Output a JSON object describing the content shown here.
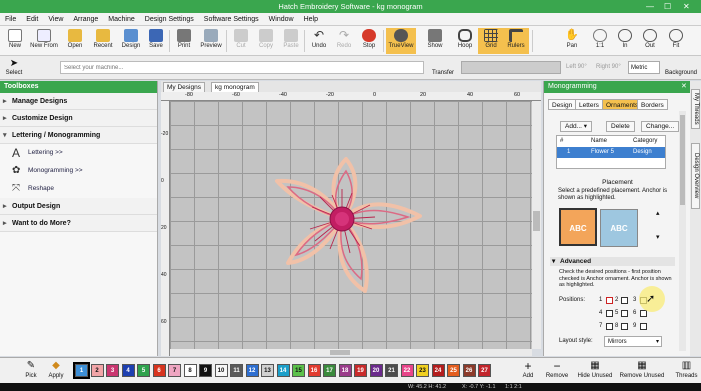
{
  "window": {
    "title": "Hatch Embroidery Software - kg monogram",
    "minimize": "—",
    "maximize": "☐",
    "close": "✕"
  },
  "menu": [
    "File",
    "Edit",
    "View",
    "Arrange",
    "Machine",
    "Design Settings",
    "Software Settings",
    "Window",
    "Help"
  ],
  "toolbar": [
    {
      "label": "New",
      "icon": "new-file-icon"
    },
    {
      "label": "New From",
      "icon": "new-from-icon"
    },
    {
      "label": "Open",
      "icon": "open-folder-icon"
    },
    {
      "label": "Recent",
      "icon": "recent-icon"
    },
    {
      "label": "Design",
      "icon": "design-icon"
    },
    {
      "label": "Save",
      "icon": "save-icon"
    },
    {
      "label": "Print",
      "icon": "print-icon"
    },
    {
      "label": "Preview",
      "icon": "preview-icon"
    },
    {
      "label": "Cut",
      "icon": "cut-icon"
    },
    {
      "label": "Copy",
      "icon": "copy-icon"
    },
    {
      "label": "Paste",
      "icon": "paste-icon"
    },
    {
      "label": "Undo",
      "icon": "undo-icon"
    },
    {
      "label": "Redo",
      "icon": "redo-icon"
    },
    {
      "label": "Stop",
      "icon": "stop-icon"
    },
    {
      "label": "TrueView",
      "icon": "trueview-icon"
    },
    {
      "label": "Show",
      "icon": "show-icon"
    },
    {
      "label": "Hoop",
      "icon": "hoop-icon"
    },
    {
      "label": "Grid",
      "icon": "grid-icon"
    },
    {
      "label": "Rulers",
      "icon": "rulers-icon"
    },
    {
      "label": "Pan",
      "icon": "pan-icon"
    },
    {
      "label": "1:1",
      "icon": "one-to-one-icon"
    },
    {
      "label": "In",
      "icon": "zoom-in-icon"
    },
    {
      "label": "Out",
      "icon": "zoom-out-icon"
    },
    {
      "label": "Fit",
      "icon": "fit-icon"
    }
  ],
  "toolbar2": {
    "select": "Select",
    "machine_placeholder": "Select your machine...",
    "transfer": "Transfer",
    "left90": "Left 90°",
    "right90": "Right 90°",
    "units": "Metric",
    "background": "Background"
  },
  "toolboxes": {
    "title": "Toolboxes",
    "sections": [
      "Manage Designs",
      "Customize Design",
      "Lettering / Monogramming",
      "Output Design",
      "Want to do More?"
    ],
    "items": [
      "Lettering >>",
      "Monogramming >>",
      "Reshape"
    ]
  },
  "doc_tabs": [
    "My Designs",
    "kg monogram"
  ],
  "rulers": {
    "top": [
      "-80",
      "-60",
      "-40",
      "-20",
      "0",
      "20",
      "40",
      "60"
    ],
    "left": [
      "-20",
      "0",
      "20",
      "40",
      "60",
      "80"
    ]
  },
  "monogramming": {
    "title": "Monogramming",
    "tabs": [
      "Design",
      "Letters",
      "Ornaments",
      "Borders"
    ],
    "buttons": {
      "add": "Add...",
      "delete": "Delete",
      "change": "Change..."
    },
    "table_headers": [
      "#",
      "Name",
      "Category"
    ],
    "rows": [
      {
        "num": "1",
        "name": "Flower 5",
        "category": "Design"
      }
    ],
    "placement_title": "Placement",
    "placement_text": "Select a predefined placement. Anchor is shown as highlighted.",
    "tiles": [
      "ABC",
      "ABC"
    ],
    "advanced_title": "Advanced",
    "advanced_text": "Check the desired positions - first position checked is Anchor ornament. Anchor is shown as highlighted.",
    "positions_label": "Positions:",
    "positions": [
      "1",
      "2",
      "3",
      "4",
      "5",
      "6",
      "7",
      "8",
      "9"
    ],
    "layout_label": "Layout style:",
    "layout_value": "Mirrors"
  },
  "side_tabs": [
    "My Threads",
    "Design Overview"
  ],
  "palette": {
    "pick": "Pick",
    "apply": "Apply",
    "swatches": [
      {
        "n": "1",
        "color": "#3d8fd6"
      },
      {
        "n": "2",
        "color": "#f2a5a8"
      },
      {
        "n": "3",
        "color": "#c93670"
      },
      {
        "n": "4",
        "color": "#1d3fb0"
      },
      {
        "n": "5",
        "color": "#2fa24d"
      },
      {
        "n": "6",
        "color": "#d7341f"
      },
      {
        "n": "7",
        "color": "#efa6c2"
      },
      {
        "n": "8",
        "color": "#ffffff"
      },
      {
        "n": "9",
        "color": "#111111"
      },
      {
        "n": "10",
        "color": "#f7f7f7"
      },
      {
        "n": "11",
        "color": "#5a5a5a"
      },
      {
        "n": "12",
        "color": "#2e6fd1"
      },
      {
        "n": "13",
        "color": "#d0d0d0"
      },
      {
        "n": "14",
        "color": "#1c9fc9"
      },
      {
        "n": "15",
        "color": "#5bc04a"
      },
      {
        "n": "16",
        "color": "#e23c30"
      },
      {
        "n": "17",
        "color": "#3a8a3c"
      },
      {
        "n": "18",
        "color": "#9a3b8a"
      },
      {
        "n": "19",
        "color": "#c82b2b"
      },
      {
        "n": "20",
        "color": "#6b2a8c"
      },
      {
        "n": "21",
        "color": "#4d4d4d"
      },
      {
        "n": "22",
        "color": "#e8458a"
      },
      {
        "n": "23",
        "color": "#f0d020"
      },
      {
        "n": "24",
        "color": "#b31d1d"
      },
      {
        "n": "25",
        "color": "#e35d1e"
      },
      {
        "n": "26",
        "color": "#8c3a2a"
      },
      {
        "n": "27",
        "color": "#c2252c"
      }
    ],
    "add": "Add",
    "remove": "Remove",
    "hide_unused": "Hide Unused",
    "remove_unused": "Remove Unused",
    "threads": "Threads"
  },
  "status": {
    "size": "W: 45.2 H: 41.2",
    "position": "X: -0.7 Y: -1.1",
    "zoom": "1:1 2:1"
  },
  "colors": {
    "accent": "#3aa64e",
    "highlight": "#f4c04e",
    "selection": "#3d7fcf"
  }
}
